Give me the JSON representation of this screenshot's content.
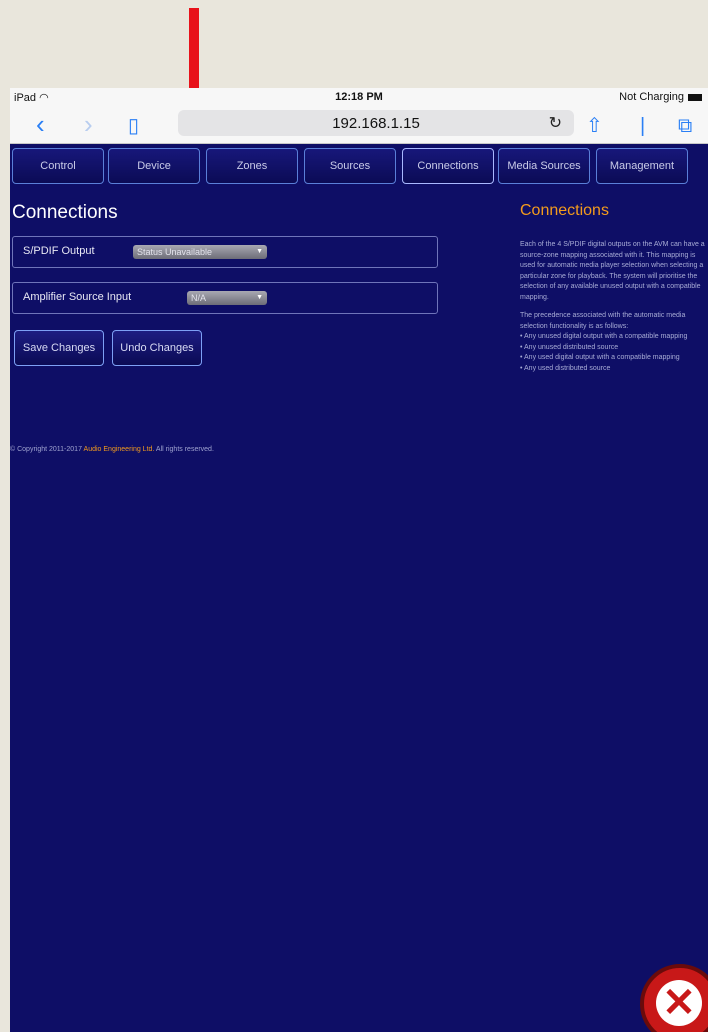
{
  "status_bar": {
    "device": "iPad",
    "wifi_icon": "wifi-icon",
    "time": "12:18 PM",
    "charging": "Not Charging"
  },
  "browser": {
    "url": "192.168.1.15",
    "back_icon": "chevron-left-icon",
    "forward_icon": "chevron-right-icon",
    "bookmarks_icon": "book-icon",
    "reload_icon": "reload-icon",
    "share_icon": "share-icon",
    "tabs_icon": "tabs-icon"
  },
  "nav": {
    "tabs": [
      {
        "label": "Control"
      },
      {
        "label": "Device"
      },
      {
        "label": "Zones"
      },
      {
        "label": "Sources"
      },
      {
        "label": "Connections"
      },
      {
        "label": "Media Sources"
      },
      {
        "label": "Management"
      }
    ],
    "active": "Connections"
  },
  "page": {
    "title": "Connections",
    "spdif": {
      "label": "S/PDIF Output",
      "value": "Status Unavailable"
    },
    "amp": {
      "label": "Amplifier Source Input",
      "value": "N/A"
    },
    "save_label": "Save Changes",
    "undo_label": "Undo Changes",
    "copyright_prefix": "© Copyright 2011-2017 ",
    "copyright_brand": "Audio Engineering Ltd.",
    "copyright_suffix": " All rights reserved."
  },
  "help": {
    "title": "Connections",
    "p1": "Each of the 4 S/PDIF digital outputs on the AVM can have a source-zone mapping associated with it. This mapping is used for automatic media player selection when selecting a particular zone for playback. The system will prioritise the selection of any available unused output with a compatible mapping.",
    "p2": "The precedence associated with the automatic media selection functionality is as follows:",
    "bullets": [
      "• Any unused digital output with a compatible mapping",
      "• Any unused distributed source",
      "• Any used digital output with a compatible mapping",
      "• Any used distributed source"
    ]
  },
  "colors": {
    "page_bg": "#0e0e66",
    "accent_orange": "#f39b1d",
    "arrow_red": "#e8121a"
  }
}
